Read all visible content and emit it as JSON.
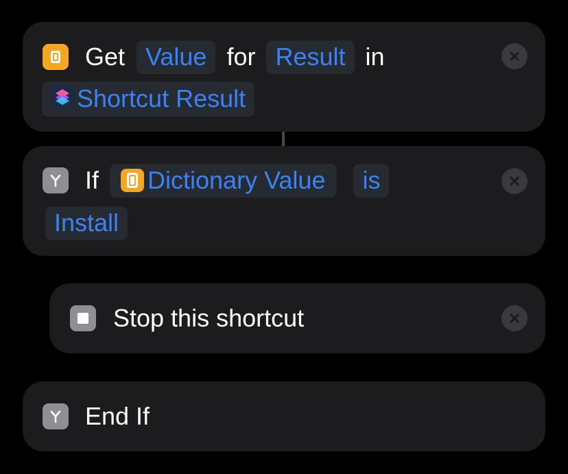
{
  "actions": {
    "get_value": {
      "keyword_get": "Get",
      "param_value": "Value",
      "keyword_for": "for",
      "param_key": "Result",
      "keyword_in": "in",
      "param_source": "Shortcut Result",
      "icon": "dictionary-icon",
      "source_icon": "shortcuts-app-icon"
    },
    "if": {
      "keyword_if": "If",
      "param_input": "Dictionary Value",
      "param_condition": "is",
      "param_compare": "Install",
      "icon": "branch-icon",
      "input_icon": "dictionary-icon"
    },
    "stop": {
      "label": "Stop this shortcut",
      "icon": "stop-icon"
    },
    "end_if": {
      "label": "End If",
      "icon": "branch-icon"
    }
  },
  "colors": {
    "background": "#000000",
    "card": "#1c1c1e",
    "token_text": "#3b82f6",
    "token_bg": "#262a31",
    "dictionary_icon": "#f5a623",
    "scripting_icon": "#8e8e93"
  }
}
